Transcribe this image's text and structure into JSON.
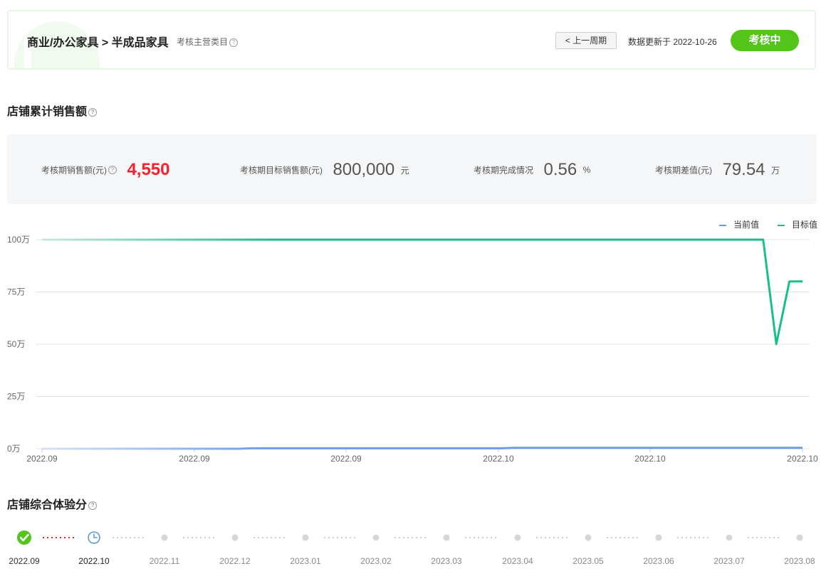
{
  "header": {
    "category_path": "商业/办公家具 > 半成品家具",
    "category_sub": "考核主营类目",
    "prev_cycle_button": "< 上一周期",
    "update_text": "数据更新于 2022-10-26",
    "status": "考核中",
    "status_color": "#52c41a"
  },
  "sales_section": {
    "title": "店铺累计销售额",
    "stats": [
      {
        "label": "考核期销售额(元)",
        "value": "4,550",
        "unit": "",
        "highlight": true,
        "help": true
      },
      {
        "label": "考核期目标销售额(元)",
        "value": "800,000",
        "unit": "元",
        "highlight": false,
        "help": false
      },
      {
        "label": "考核期完成情况",
        "value": "0.56",
        "unit": "%",
        "highlight": false,
        "help": false
      },
      {
        "label": "考核期差值(元)",
        "value": "79.54",
        "unit": "万",
        "highlight": false,
        "help": false
      }
    ]
  },
  "chart_data": {
    "type": "line",
    "x_tick_labels": [
      "2022.09",
      "2022.09",
      "2022.09",
      "2022.10",
      "2022.10",
      "2022.10"
    ],
    "y_tick_labels": [
      "100万",
      "75万",
      "50万",
      "25万",
      "0万"
    ],
    "ylim": [
      0,
      1000000
    ],
    "grid": true,
    "legend_position": "top-right",
    "series": [
      {
        "name": "当前值",
        "color": "#6b9be6",
        "values": [
          0,
          0,
          0,
          0,
          0,
          0,
          0,
          0,
          0,
          0,
          0,
          0,
          0,
          0,
          0,
          0,
          2000,
          2000,
          2000,
          2000,
          2000,
          2000,
          2000,
          2000,
          2000,
          2000,
          2000,
          2000,
          2000,
          2000,
          2000,
          2000,
          2000,
          2000,
          2000,
          2000,
          4550,
          4550,
          4550,
          4550,
          4550,
          4550,
          4550,
          4550,
          4550,
          4550,
          4550,
          4550,
          4550,
          4550,
          4550,
          4550,
          4550,
          4550,
          4550,
          4550,
          4550,
          4550,
          4550
        ]
      },
      {
        "name": "目标值",
        "color": "#13c386",
        "values": [
          1000000,
          1000000,
          1000000,
          1000000,
          1000000,
          1000000,
          1000000,
          1000000,
          1000000,
          1000000,
          1000000,
          1000000,
          1000000,
          1000000,
          1000000,
          1000000,
          1000000,
          1000000,
          1000000,
          1000000,
          1000000,
          1000000,
          1000000,
          1000000,
          1000000,
          1000000,
          1000000,
          1000000,
          1000000,
          1000000,
          1000000,
          1000000,
          1000000,
          1000000,
          1000000,
          1000000,
          1000000,
          1000000,
          1000000,
          1000000,
          1000000,
          1000000,
          1000000,
          1000000,
          1000000,
          1000000,
          1000000,
          1000000,
          1000000,
          1000000,
          1000000,
          1000000,
          1000000,
          1000000,
          1000000,
          1000000,
          500000,
          800000,
          800000
        ]
      }
    ]
  },
  "experience_section": {
    "title": "店铺综合体验分",
    "timeline": [
      {
        "label": "2022.09",
        "state": "done"
      },
      {
        "label": "2022.10",
        "state": "current"
      },
      {
        "label": "2022.11",
        "state": "future"
      },
      {
        "label": "2022.12",
        "state": "future"
      },
      {
        "label": "2023.01",
        "state": "future"
      },
      {
        "label": "2023.02",
        "state": "future"
      },
      {
        "label": "2023.03",
        "state": "future"
      },
      {
        "label": "2023.04",
        "state": "future"
      },
      {
        "label": "2023.05",
        "state": "future"
      },
      {
        "label": "2023.06",
        "state": "future"
      },
      {
        "label": "2023.07",
        "state": "future"
      },
      {
        "label": "2023.08",
        "state": "future"
      }
    ]
  }
}
